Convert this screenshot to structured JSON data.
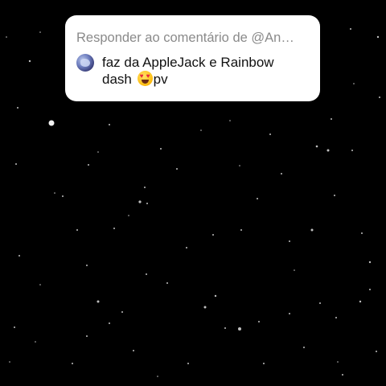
{
  "reply_card": {
    "header": "Responder ao comentário de @An…",
    "comment_text": "faz da AppleJack e Rainbow dash",
    "comment_suffix": "pv",
    "emoji": "smiling-face-with-heart-eyes"
  },
  "colors": {
    "background": "#000000",
    "card": "#ffffff",
    "header_text": "#8a8a8a",
    "comment_text": "#111111"
  }
}
